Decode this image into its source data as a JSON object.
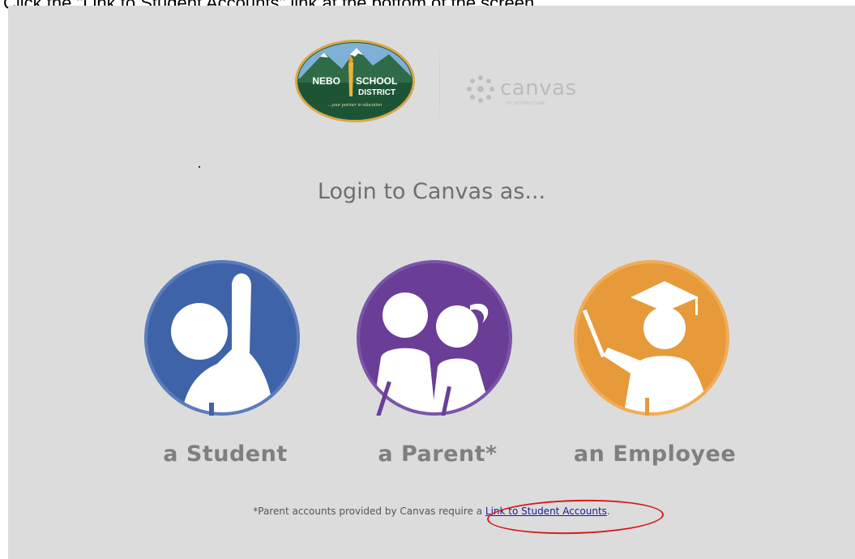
{
  "instruction": "Click the \"Link to Student Accounts\" link at the bottom of the screen.",
  "logo": {
    "line1_left": "NEBO",
    "line1_right": "SCHOOL",
    "line2": "DISTRICT",
    "tagline": "...your partner in education"
  },
  "canvas_brand": {
    "word": "canvas",
    "sub": "BY INSTRUCTURE"
  },
  "heading": "Login to Canvas as...",
  "roles": [
    {
      "label": "a Student",
      "color": "#3e63a8",
      "icon": "student-raised-hand-icon"
    },
    {
      "label": "a Parent*",
      "color": "#6a3e97",
      "icon": "parents-icon"
    },
    {
      "label": "an Employee",
      "color": "#e69a3a",
      "icon": "teacher-graduate-icon"
    }
  ],
  "footer": {
    "prefix": "*Parent accounts provided by Canvas require a ",
    "link": "Link to Student Accounts",
    "suffix": "."
  },
  "highlight_color": "#d61a1a"
}
